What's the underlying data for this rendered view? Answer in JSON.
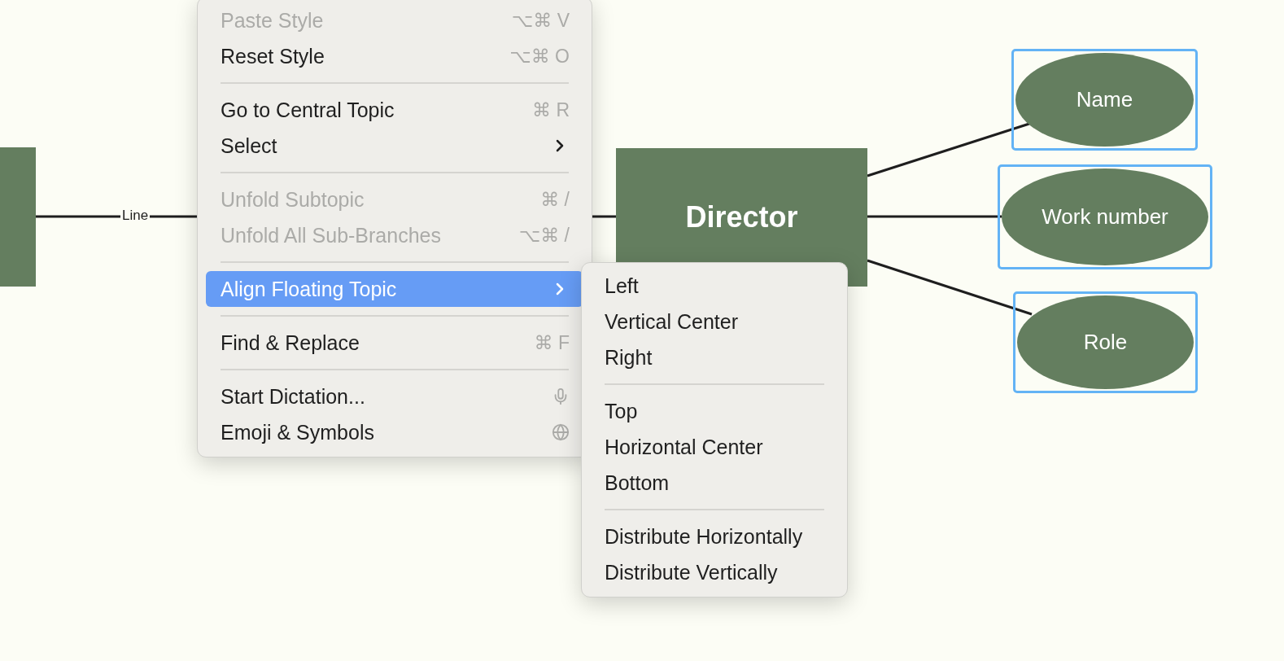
{
  "canvas": {
    "left_topic": {
      "kind": "rect"
    },
    "connector_label": "Line",
    "central_topic": {
      "title": "Director"
    },
    "subtopics": [
      {
        "title": "Name",
        "selected": true
      },
      {
        "title": "Work number",
        "selected": true
      },
      {
        "title": "Role",
        "selected": true
      }
    ]
  },
  "context_menu": {
    "items": [
      {
        "kind": "item",
        "label": "Paste Style",
        "shortcut": "⌥⌘ V",
        "disabled": true,
        "selected": false
      },
      {
        "kind": "item",
        "label": "Reset Style",
        "shortcut": "⌥⌘ O",
        "disabled": false,
        "selected": false
      },
      {
        "kind": "separator"
      },
      {
        "kind": "item",
        "label": "Go to Central Topic",
        "shortcut": "⌘ R",
        "disabled": false,
        "selected": false
      },
      {
        "kind": "submenu",
        "label": "Select",
        "disabled": false,
        "selected": false
      },
      {
        "kind": "separator"
      },
      {
        "kind": "item",
        "label": "Unfold Subtopic",
        "shortcut": "⌘ /",
        "disabled": true,
        "selected": false
      },
      {
        "kind": "item",
        "label": "Unfold All Sub-Branches",
        "shortcut": "⌥⌘ /",
        "disabled": true,
        "selected": false
      },
      {
        "kind": "separator"
      },
      {
        "kind": "submenu",
        "label": "Align Floating Topic",
        "disabled": false,
        "selected": true
      },
      {
        "kind": "separator"
      },
      {
        "kind": "item",
        "label": "Find & Replace",
        "shortcut": "⌘ F",
        "disabled": false,
        "selected": false
      },
      {
        "kind": "separator"
      },
      {
        "kind": "dictation",
        "label": "Start Dictation...",
        "disabled": false,
        "selected": false
      },
      {
        "kind": "emoji",
        "label": "Emoji & Symbols",
        "disabled": false,
        "selected": false
      }
    ]
  },
  "submenu": {
    "items": [
      {
        "kind": "item",
        "label": "Left"
      },
      {
        "kind": "item",
        "label": "Vertical Center"
      },
      {
        "kind": "item",
        "label": "Right"
      },
      {
        "kind": "separator"
      },
      {
        "kind": "item",
        "label": "Top"
      },
      {
        "kind": "item",
        "label": "Horizontal Center"
      },
      {
        "kind": "item",
        "label": "Bottom"
      },
      {
        "kind": "separator"
      },
      {
        "kind": "item",
        "label": "Distribute Horizontally"
      },
      {
        "kind": "item",
        "label": "Distribute Vertically"
      }
    ]
  }
}
